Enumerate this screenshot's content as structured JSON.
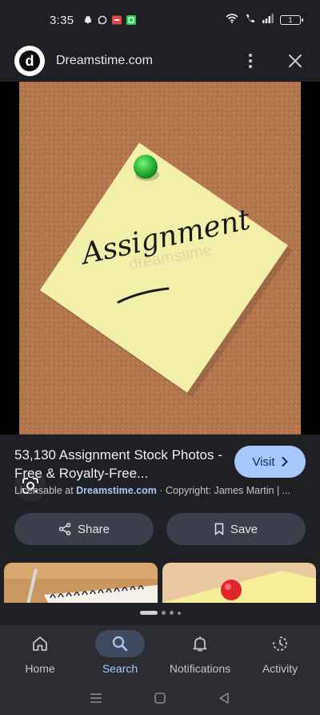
{
  "status_bar": {
    "time": "3:35",
    "battery": "1",
    "left_icons": [
      "snapchat-icon",
      "whatsapp-icon",
      "sos-icon",
      "app-icon"
    ],
    "right_icons": [
      "wifi-icon",
      "volte-call-icon",
      "signal-icon",
      "battery-icon"
    ]
  },
  "header": {
    "site_name": "Dreamstime.com",
    "logo_letter": "d"
  },
  "image": {
    "note_text": "Assignment",
    "watermark": "dreamstime"
  },
  "result": {
    "title": "53,130 Assignment Stock Photos - Free & Royalty-Free...",
    "visit_label": "Visit",
    "license_prefix": "Licensable at",
    "license_source": "Dreamstime.com",
    "license_suffix": "· Copyright: James Martin | ..."
  },
  "actions": {
    "share_label": "Share",
    "save_label": "Save"
  },
  "nav": {
    "items": [
      {
        "label": "Home",
        "icon": "home-icon",
        "active": false
      },
      {
        "label": "Search",
        "icon": "search-icon",
        "active": true
      },
      {
        "label": "Notifications",
        "icon": "bell-icon",
        "active": false
      },
      {
        "label": "Activity",
        "icon": "activity-icon",
        "active": false
      }
    ]
  },
  "colors": {
    "background": "#1f2024",
    "accent": "#a8c7fa",
    "button_bg": "#3a3f4b",
    "nav_bg": "#2c2d33",
    "cork": "#b5784f",
    "sticky_note": "#f2f0a8",
    "pin": "#2fbf3a"
  }
}
